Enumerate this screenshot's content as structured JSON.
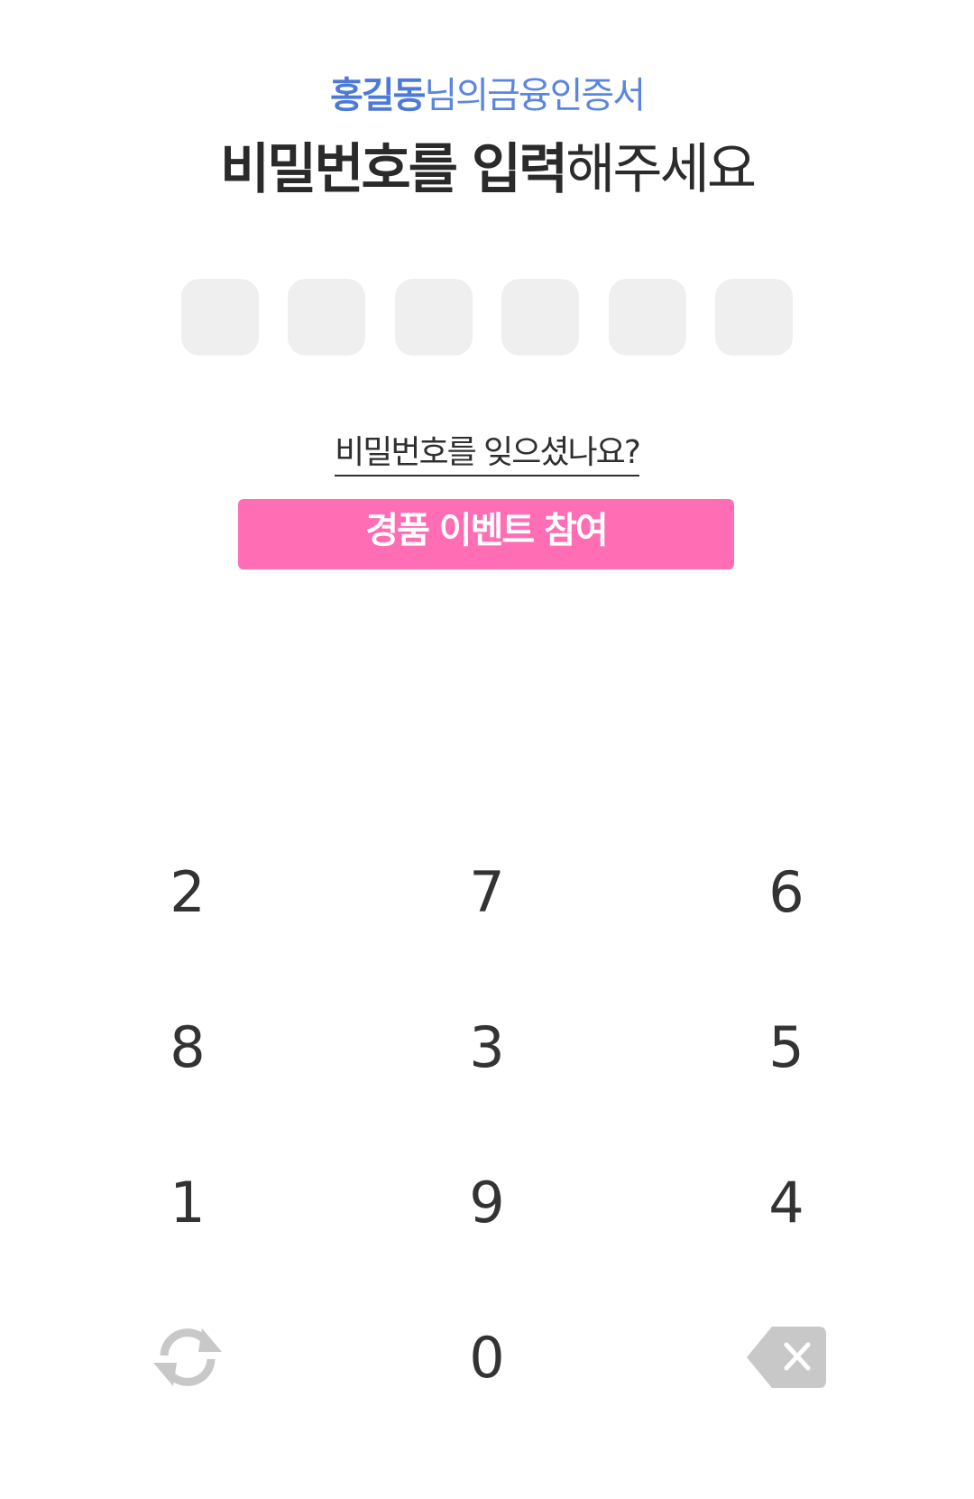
{
  "header": {
    "cert_name": "홍길동",
    "cert_suffix": "님의금융인증서",
    "title_bold": "비밀번호를 입력",
    "title_regular": "해주세요"
  },
  "pin": {
    "length": 6
  },
  "links": {
    "forgot_password": "비밀번호를 잊으셨나요?"
  },
  "buttons": {
    "event": "경품 이벤트 참여"
  },
  "keypad": {
    "keys": [
      "2",
      "7",
      "6",
      "8",
      "3",
      "5",
      "1",
      "9",
      "4",
      "0"
    ],
    "refresh_icon": "refresh-icon",
    "backspace_icon": "backspace-icon"
  },
  "colors": {
    "accent_blue": "#4d7ad9",
    "event_pink": "#ff6db5",
    "pin_box": "#efefef",
    "icon_gray": "#c8c8c8"
  }
}
